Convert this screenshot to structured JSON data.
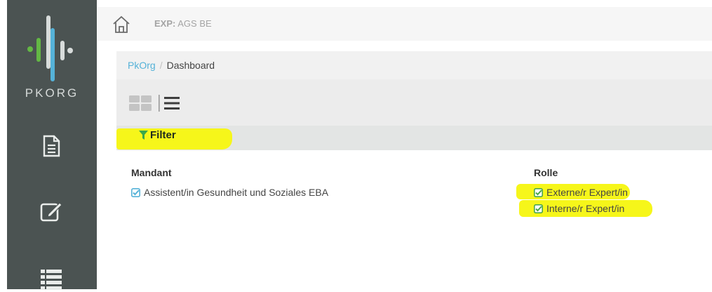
{
  "sidebar": {
    "logo_text": "PKORG",
    "items": [
      {
        "icon": "document-icon"
      },
      {
        "icon": "edit-icon"
      },
      {
        "icon": "list-icon"
      }
    ]
  },
  "topbar": {
    "exp_label": "EXP:",
    "exp_value": "AGS BE"
  },
  "breadcrumb": {
    "link": "PkOrg",
    "separator": "/",
    "current": "Dashboard"
  },
  "filter": {
    "title": "Filter",
    "mandant": {
      "header": "Mandant",
      "options": [
        {
          "label": "Assistent/in Gesundheit und Soziales EBA",
          "checked": true
        }
      ]
    },
    "rolle": {
      "header": "Rolle",
      "options": [
        {
          "label": "Externe/r Expert/in",
          "checked": true
        },
        {
          "label": "Interne/r Expert/in",
          "checked": true
        }
      ]
    }
  },
  "colors": {
    "sidebar": "#4b5352",
    "accent_blue": "#55b2d8",
    "accent_green": "#63b844",
    "highlight": "#f6f61a"
  }
}
